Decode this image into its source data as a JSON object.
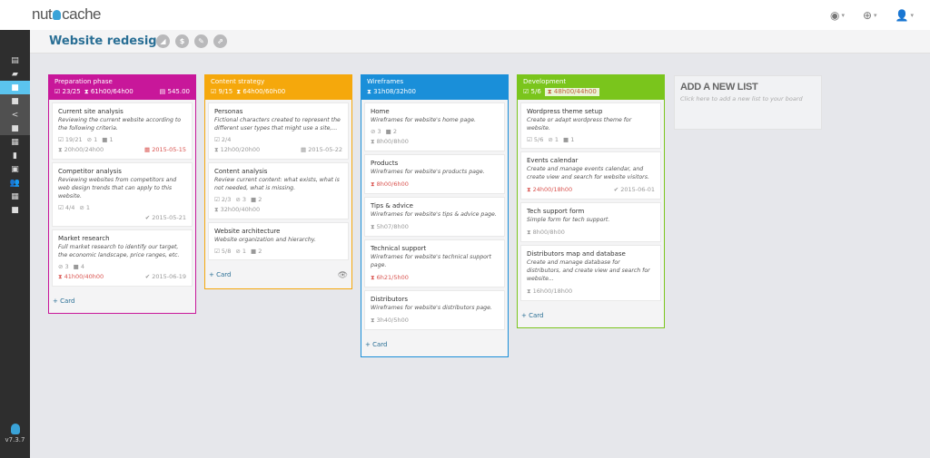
{
  "app": {
    "logo": {
      "left": "nut",
      "right": "cache"
    },
    "top_icons": [
      {
        "name": "globe-icon",
        "glyph": "◉"
      },
      {
        "name": "support-icon",
        "glyph": "⊕"
      },
      {
        "name": "user-icon",
        "glyph": "👤"
      }
    ],
    "version": "v7.3.7"
  },
  "sidebar": {
    "items": [
      {
        "name": "dashboard",
        "glyph": "▤",
        "state": "normal"
      },
      {
        "name": "projects",
        "glyph": "▰",
        "state": "normal"
      },
      {
        "name": "board",
        "glyph": "■",
        "state": "active"
      },
      {
        "name": "sub-item-1",
        "glyph": "■",
        "state": "sub"
      },
      {
        "name": "share",
        "glyph": "<",
        "state": "sub"
      },
      {
        "name": "sub-item-2",
        "glyph": "■",
        "state": "sub"
      },
      {
        "name": "calendar",
        "glyph": "▦",
        "state": "normal"
      },
      {
        "name": "documents",
        "glyph": "▮",
        "state": "normal"
      },
      {
        "name": "calculator",
        "glyph": "▣",
        "state": "normal"
      },
      {
        "name": "users",
        "glyph": "👥",
        "state": "normal"
      },
      {
        "name": "grid",
        "glyph": "▦",
        "state": "normal"
      },
      {
        "name": "notes",
        "glyph": "■",
        "state": "normal"
      }
    ]
  },
  "header": {
    "title": "Website redesign",
    "icons": [
      {
        "name": "chart-icon",
        "glyph": "◢"
      },
      {
        "name": "dollar-icon",
        "glyph": "$"
      },
      {
        "name": "edit-icon",
        "glyph": "✎"
      },
      {
        "name": "share-icon",
        "glyph": "⇗"
      }
    ]
  },
  "lists": [
    {
      "title": "Preparation phase",
      "color": "#c8179a",
      "tasks": "☑ 23/25",
      "time": "⧗ 61h00/64h00",
      "budget": "▤ 545.00",
      "cards": [
        {
          "title": "Current site analysis",
          "desc": "Reviewing the current website according to the following criteria.",
          "meta": [
            "☑ 19/21",
            "⊘ 1",
            "■ 1"
          ],
          "time": "⧗ 20h00/24h00",
          "time_over": false,
          "date": "▦ 2015-05-15",
          "date_over": true
        },
        {
          "title": "Competitor analysis",
          "desc": "Reviewing websites from competitors and web design trends that can apply to this website.",
          "meta": [
            "☑ 4/4",
            "⊘ 1"
          ],
          "time": "",
          "time_over": false,
          "date": "✔ 2015-05-21",
          "date_over": false
        },
        {
          "title": "Market research",
          "desc": "Full market research to identify our target, the economic landscape, price ranges, etc.",
          "meta": [
            "⊘ 3",
            "■ 4"
          ],
          "time": "⧗ 41h00/40h00",
          "time_over": true,
          "date": "✔ 2015-06-19",
          "date_over": false
        }
      ],
      "add_card": "+ Card"
    },
    {
      "title": "Content strategy",
      "color": "#f5a80c",
      "tasks": "☑ 9/15",
      "time": "⧗ 64h00/60h00",
      "budget": "",
      "cards": [
        {
          "title": "Personas",
          "desc": "Fictional characters created to represent the different user types that might use a site,...",
          "meta": [
            "☑ 2/4"
          ],
          "time": "⧗ 12h00/20h00",
          "time_over": false,
          "date": "▦ 2015-05-22",
          "date_over": false
        },
        {
          "title": "Content analysis",
          "desc": "Review current content: what exists, what is not needed, what is missing.",
          "meta": [
            "☑ 2/3",
            "⊘ 3",
            "■ 2"
          ],
          "time": "⧗ 32h00/40h00",
          "time_over": false,
          "date": "",
          "date_over": false
        },
        {
          "title": "Website architecture",
          "desc": "Website organization and hierarchy.",
          "meta": [
            "☑ 5/8",
            "⊘ 1",
            "■ 2"
          ],
          "time": "",
          "time_over": false,
          "date": "",
          "date_over": false
        }
      ],
      "add_card": "+ Card",
      "watch": "👁"
    },
    {
      "title": "Wireframes",
      "color": "#1a8fd9",
      "tasks": "",
      "time": "⧗ 31h08/32h00",
      "budget": "",
      "cards": [
        {
          "title": "Home",
          "desc": "Wireframes for website's home page.",
          "meta": [
            "⊘ 3",
            "■ 2"
          ],
          "time": "⧗ 8h00/8h00",
          "time_over": false,
          "date": "",
          "date_over": false
        },
        {
          "title": "Products",
          "desc": "Wireframes for website's products page.",
          "meta": [],
          "time": "⧗ 8h00/6h00",
          "time_over": true,
          "date": "",
          "date_over": false
        },
        {
          "title": "Tips & advice",
          "desc": "Wireframes for website's tips & advice page.",
          "meta": [],
          "time": "⧗ 5h07/8h00",
          "time_over": false,
          "date": "",
          "date_over": false
        },
        {
          "title": "Technical support",
          "desc": "Wireframes for website's technical support page.",
          "meta": [],
          "time": "⧗ 6h21/5h00",
          "time_over": true,
          "date": "",
          "date_over": false
        },
        {
          "title": "Distributors",
          "desc": "Wireframes for website's distributors page.",
          "meta": [],
          "time": "⧗ 3h40/5h00",
          "time_over": false,
          "date": "",
          "date_over": false
        }
      ],
      "add_card": "+ Card"
    },
    {
      "title": "Development",
      "color": "#7ac51c",
      "tasks": "☑ 5/6",
      "time": "⧗ 48h00/44h00",
      "time_highlight": true,
      "budget": "",
      "cards": [
        {
          "title": "Wordpress theme setup",
          "desc": "Create or adapt wordpress theme for website.",
          "meta": [
            "☑ 5/6",
            "⊘ 1",
            "■ 1"
          ],
          "time": "",
          "time_over": false,
          "date": "",
          "date_over": false
        },
        {
          "title": "Events calendar",
          "desc": "Create and manage events calendar, and create view and search for website visitors.",
          "meta": [],
          "time": "⧗ 24h00/18h00",
          "time_over": true,
          "date": "✔ 2015-06-01",
          "date_over": false
        },
        {
          "title": "Tech support form",
          "desc": "Simple form for tech support.",
          "meta": [],
          "time": "⧗ 8h00/8h00",
          "time_over": false,
          "date": "",
          "date_over": false
        },
        {
          "title": "Distributors map and database",
          "desc": "Create and manage database for distributors, and create view and search for website...",
          "meta": [],
          "time": "⧗ 16h00/18h00",
          "time_over": false,
          "date": "",
          "date_over": false
        }
      ],
      "add_card": "+ Card"
    }
  ],
  "add_list": {
    "title": "ADD A NEW LIST",
    "subtitle": "Click here to add a new list to your board"
  }
}
